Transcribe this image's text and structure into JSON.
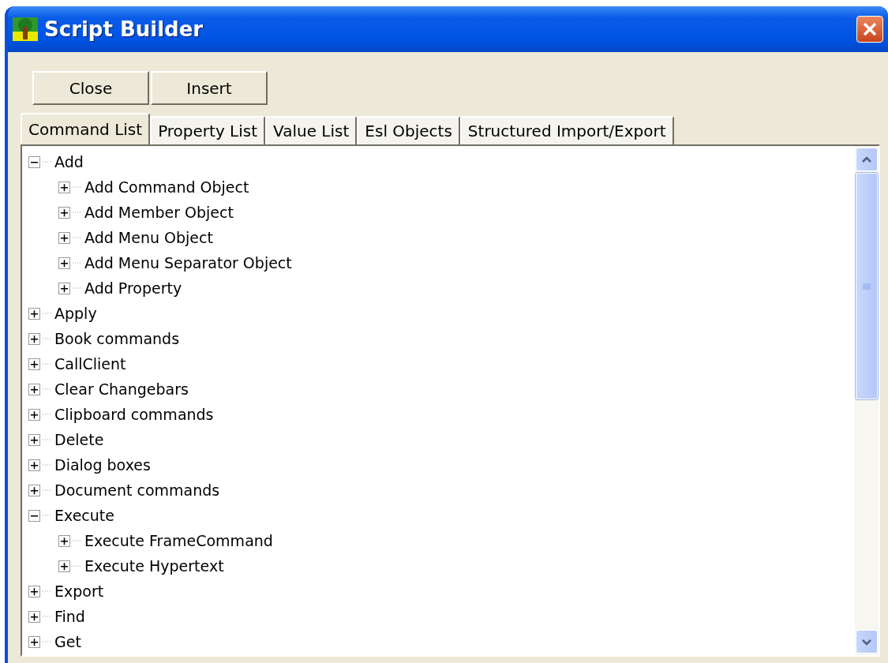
{
  "window": {
    "title": "Script Builder"
  },
  "buttons": [
    "Close",
    "Insert"
  ],
  "tabs": [
    {
      "label": "Command List",
      "selected": true
    },
    {
      "label": "Property List",
      "selected": false
    },
    {
      "label": "Value List",
      "selected": false
    },
    {
      "label": "Esl Objects",
      "selected": false
    },
    {
      "label": "Structured Import/Export",
      "selected": false
    }
  ],
  "tree": [
    {
      "label": "Add",
      "expanded": true,
      "children": [
        {
          "label": "Add Command Object",
          "expanded": false
        },
        {
          "label": "Add Member Object",
          "expanded": false
        },
        {
          "label": "Add Menu Object",
          "expanded": false
        },
        {
          "label": "Add Menu Separator Object",
          "expanded": false
        },
        {
          "label": "Add Property",
          "expanded": false
        }
      ]
    },
    {
      "label": "Apply",
      "expanded": false
    },
    {
      "label": "Book commands",
      "expanded": false
    },
    {
      "label": "CallClient",
      "expanded": false
    },
    {
      "label": "Clear Changebars",
      "expanded": false
    },
    {
      "label": "Clipboard commands",
      "expanded": false
    },
    {
      "label": "Delete",
      "expanded": false
    },
    {
      "label": "Dialog boxes",
      "expanded": false
    },
    {
      "label": "Document commands",
      "expanded": false
    },
    {
      "label": "Execute",
      "expanded": true,
      "children": [
        {
          "label": "Execute FrameCommand",
          "expanded": false
        },
        {
          "label": "Execute Hypertext",
          "expanded": false
        }
      ]
    },
    {
      "label": "Export",
      "expanded": false
    },
    {
      "label": "Find",
      "expanded": false
    },
    {
      "label": "Get",
      "expanded": false
    }
  ]
}
